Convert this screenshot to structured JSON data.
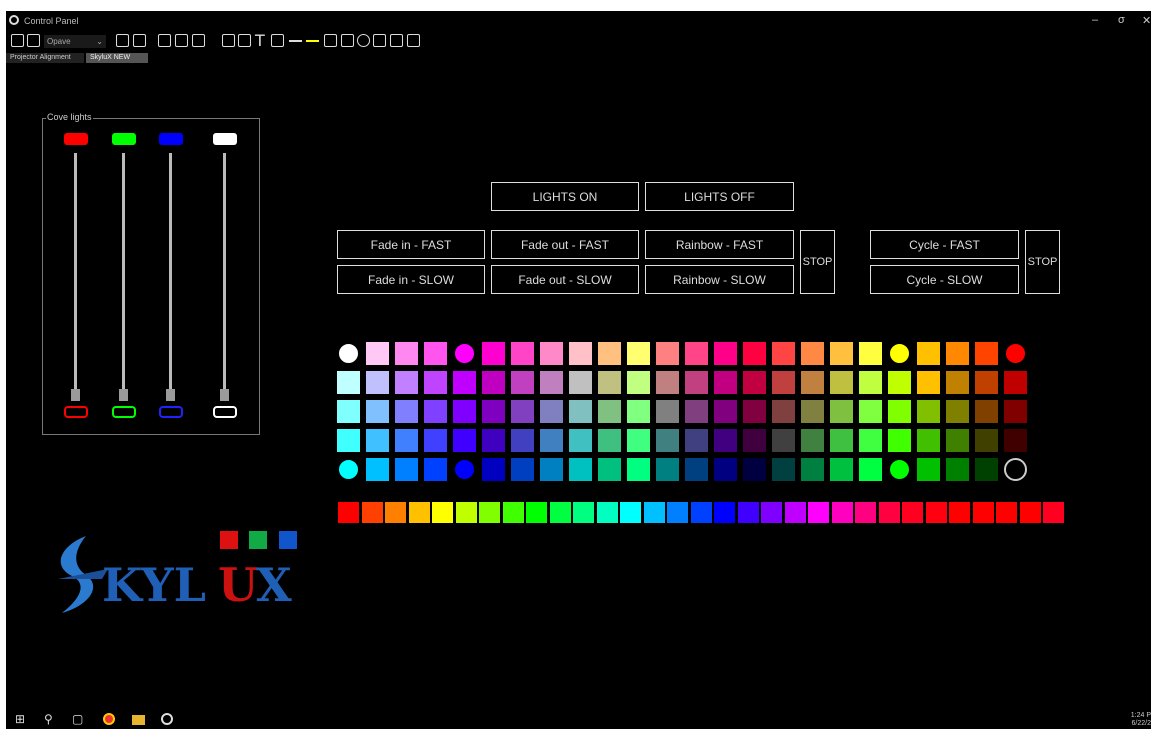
{
  "window": {
    "title": "Control Panel",
    "minimize": "–",
    "restore": "σ",
    "close": "✕"
  },
  "toolbar": {
    "font_combo": {
      "value": "Opave",
      "chevron": "⌄"
    },
    "text_tool_glyph": "T"
  },
  "tabs": [
    {
      "label": "Projector Alignment",
      "active": false
    },
    {
      "label": "SkyluX NEW",
      "active": true
    }
  ],
  "cove": {
    "label": "Cove lights",
    "sliders": [
      {
        "color": "#ff0000",
        "level": 0
      },
      {
        "color": "#00ff00",
        "level": 0
      },
      {
        "color": "#0000ff",
        "level": 0
      },
      {
        "color": "#ffffff",
        "level": 0
      }
    ]
  },
  "buttons": {
    "lights_on": "LIGHTS ON",
    "lights_off": "LIGHTS OFF",
    "fade_in_fast": "Fade in - FAST",
    "fade_in_slow": "Fade in - SLOW",
    "fade_out_fast": "Fade out - FAST",
    "fade_out_slow": "Fade out - SLOW",
    "rainbow_fast": "Rainbow - FAST",
    "rainbow_slow": "Rainbow - SLOW",
    "stop_1": "STOP",
    "cycle_fast": "Cycle - FAST",
    "cycle_slow": "Cycle - SLOW",
    "stop_2": "STOP"
  },
  "palette": [
    [
      "#ffffff",
      "#ffc8f5",
      "#ff88f0",
      "#ff55ee",
      "#ff00ff",
      "#ff00d0",
      "#ff44c8",
      "#ff88c8",
      "#ffc0c8",
      "#ffc080",
      "#ffff70",
      "#ff8080",
      "#ff4488",
      "#ff0088",
      "#ff0040",
      "#ff4444",
      "#ff8844",
      "#ffc040",
      "#ffff40",
      "#ffff00",
      "#ffc000",
      "#ff8800",
      "#ff4400",
      "#ff0000"
    ],
    [
      "#c0ffff",
      "#c0c0ff",
      "#c080ff",
      "#c044ff",
      "#c000ff",
      "#c000c0",
      "#c040c0",
      "#c080c0",
      "#c0c0c0",
      "#c0c080",
      "#c0ff80",
      "#c08080",
      "#c04080",
      "#c00080",
      "#c00040",
      "#c04040",
      "#c08040",
      "#c0c040",
      "#c0ff40",
      "#c0ff00",
      "#ffc000",
      "#c08000",
      "#c04000",
      "#c00000"
    ],
    [
      "#80ffff",
      "#80c0ff",
      "#8080ff",
      "#8040ff",
      "#8000ff",
      "#8000c0",
      "#8040c0",
      "#8080c0",
      "#80c0c0",
      "#80c080",
      "#80ff80",
      "#808080",
      "#804080",
      "#800080",
      "#800040",
      "#804040",
      "#808040",
      "#80c040",
      "#80ff40",
      "#80ff00",
      "#80c000",
      "#808000",
      "#804000",
      "#800000"
    ],
    [
      "#40ffff",
      "#40c0ff",
      "#4080ff",
      "#4040ff",
      "#4000ff",
      "#4000c0",
      "#4040c0",
      "#4080c0",
      "#40c0c0",
      "#40c080",
      "#40ff80",
      "#408080",
      "#404080",
      "#400080",
      "#400040",
      "#404040",
      "#408040",
      "#40c040",
      "#40ff40",
      "#40ff00",
      "#40c000",
      "#408000",
      "#404000",
      "#400000"
    ],
    [
      "#00ffff",
      "#00c0ff",
      "#0080ff",
      "#0040ff",
      "#0000ff",
      "#0000c0",
      "#0040c0",
      "#0080c0",
      "#00c0c0",
      "#00c080",
      "#00ff80",
      "#008080",
      "#004080",
      "#000080",
      "#000040",
      "#004040",
      "#008040",
      "#00c040",
      "#00ff40",
      "#00ff00",
      "#00c000",
      "#008000",
      "#004000",
      "#000000"
    ]
  ],
  "rainbow": [
    "#ff0000",
    "#ff4000",
    "#ff8000",
    "#ffc000",
    "#ffff00",
    "#c0ff00",
    "#80ff00",
    "#40ff00",
    "#00ff00",
    "#00ff40",
    "#00ff80",
    "#00ffc0",
    "#00ffff",
    "#00c0ff",
    "#0080ff",
    "#0040ff",
    "#0000ff",
    "#4000ff",
    "#8000ff",
    "#c000ff",
    "#ff00ff",
    "#ff00c0",
    "#ff0080",
    "#ff0040",
    "#ff0020",
    "#ff0010",
    "#ff0000",
    "#ff0000",
    "#ff0000",
    "#ff0000",
    "#ff0020"
  ],
  "logo": {
    "text": "SKYLUX",
    "squares": [
      "#dd1111",
      "#11aa44",
      "#1155cc"
    ]
  },
  "taskbar": {
    "start": "⊞",
    "search": "⚲",
    "taskview": "▢",
    "clock_time": "1:24 P",
    "clock_date": "6/22/2"
  }
}
